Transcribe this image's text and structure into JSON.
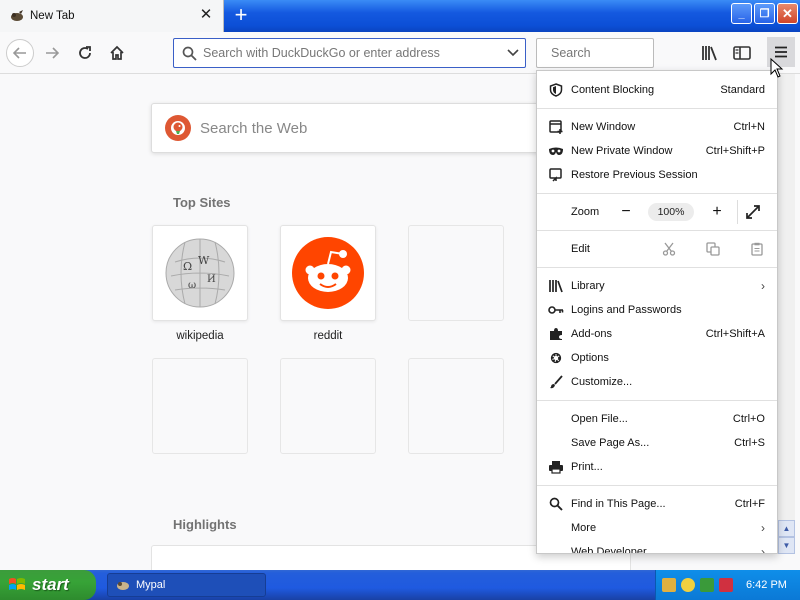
{
  "tab": {
    "title": "New Tab",
    "close_glyph": "✕"
  },
  "new_tab_glyph": "+",
  "window_buttons": {
    "minimize": "_",
    "maximize": "❐",
    "close": "✕"
  },
  "urlbar": {
    "placeholder": "Search with DuckDuckGo or enter address"
  },
  "searchbar": {
    "placeholder": "Search"
  },
  "newtab_page": {
    "search_placeholder": "Search the Web",
    "top_sites_title": "Top Sites",
    "top_sites": [
      {
        "label": "wikipedia",
        "icon": "wikipedia-icon"
      },
      {
        "label": "reddit",
        "icon": "reddit-icon"
      }
    ],
    "highlights_title": "Highlights"
  },
  "menu": {
    "content_blocking": {
      "label": "Content Blocking",
      "value": "Standard"
    },
    "new_window": {
      "label": "New Window",
      "shortcut": "Ctrl+N"
    },
    "new_private_window": {
      "label": "New Private Window",
      "shortcut": "Ctrl+Shift+P"
    },
    "restore_session": {
      "label": "Restore Previous Session"
    },
    "zoom": {
      "label": "Zoom",
      "minus": "−",
      "value": "100%",
      "plus": "+"
    },
    "edit": {
      "label": "Edit"
    },
    "library": {
      "label": "Library"
    },
    "logins": {
      "label": "Logins and Passwords"
    },
    "addons": {
      "label": "Add-ons",
      "shortcut": "Ctrl+Shift+A"
    },
    "options": {
      "label": "Options"
    },
    "customize": {
      "label": "Customize..."
    },
    "open_file": {
      "label": "Open File...",
      "shortcut": "Ctrl+O"
    },
    "save_page": {
      "label": "Save Page As...",
      "shortcut": "Ctrl+S"
    },
    "print": {
      "label": "Print..."
    },
    "find": {
      "label": "Find in This Page...",
      "shortcut": "Ctrl+F"
    },
    "more": {
      "label": "More"
    },
    "web_developer": {
      "label": "Web Developer"
    }
  },
  "taskbar": {
    "start_label": "start",
    "task_label": "Mypal",
    "clock": "6:42 PM"
  },
  "colors": {
    "accent_blue": "#0c4fd6",
    "start_green": "#37a337",
    "ddg_orange": "#de5833",
    "reddit_orange": "#ff4500"
  }
}
